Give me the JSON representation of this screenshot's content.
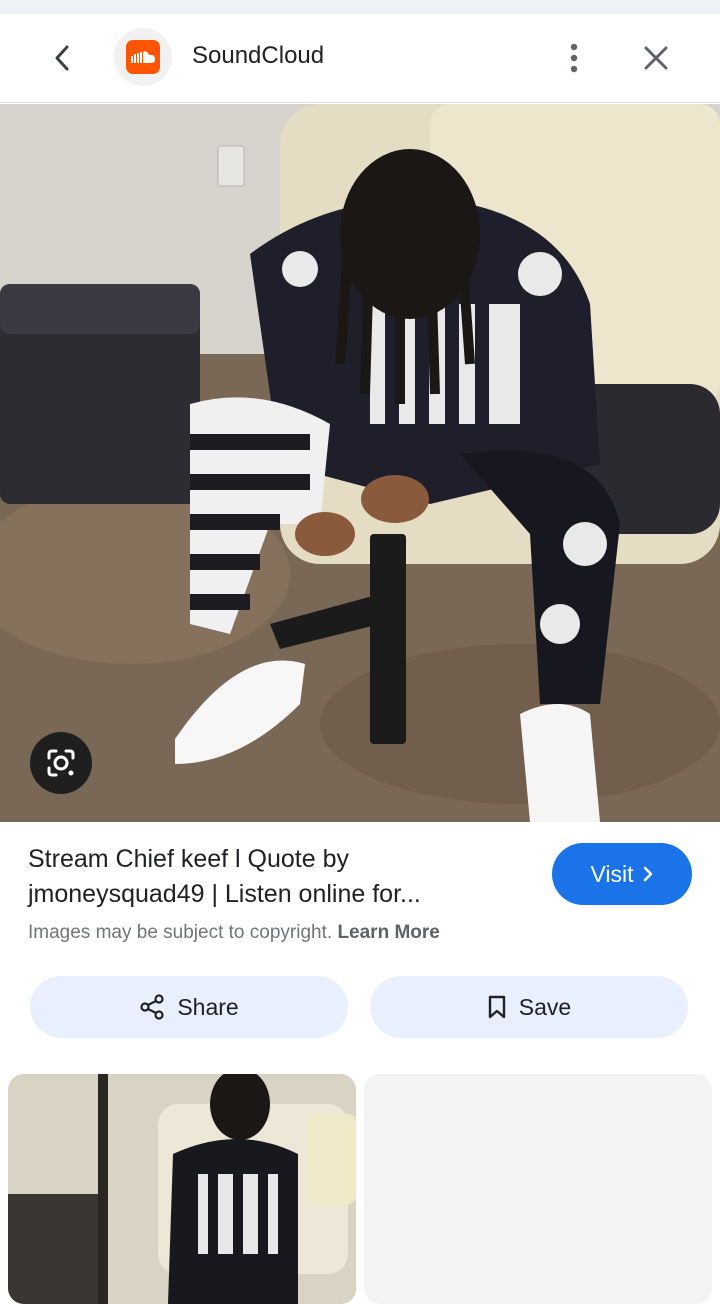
{
  "header": {
    "site_name": "SoundCloud",
    "back_icon": "chevron-left-icon",
    "more_icon": "more-vert-icon",
    "close_icon": "close-icon"
  },
  "result": {
    "title": "Stream Chief keef l Quote by jmoneysquad49 | Listen online for...",
    "visit_label": "Visit",
    "copyright_text": "Images may be subject to copyright.",
    "learn_more": "Learn More"
  },
  "actions": {
    "share_label": "Share",
    "save_label": "Save"
  },
  "colors": {
    "accent": "#1a73e8",
    "soundcloud_orange": "#ff5500",
    "chip_bg": "#e8f0fe"
  }
}
